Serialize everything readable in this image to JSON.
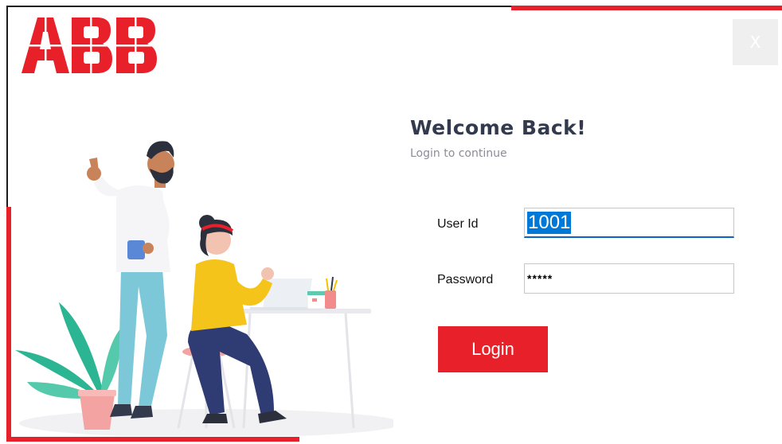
{
  "brand": {
    "logo_text": "ABB",
    "accent_color": "#e8202a"
  },
  "window": {
    "close_label": "X"
  },
  "header": {
    "title": "Welcome Back!",
    "subtitle": "Login to continue"
  },
  "form": {
    "user_id_label": "User Id",
    "user_id_value": "1001",
    "password_label": "Password",
    "password_value": "*****",
    "login_label": "Login"
  },
  "icons": {
    "close": "close-icon",
    "illustration": "office-people-illustration"
  }
}
